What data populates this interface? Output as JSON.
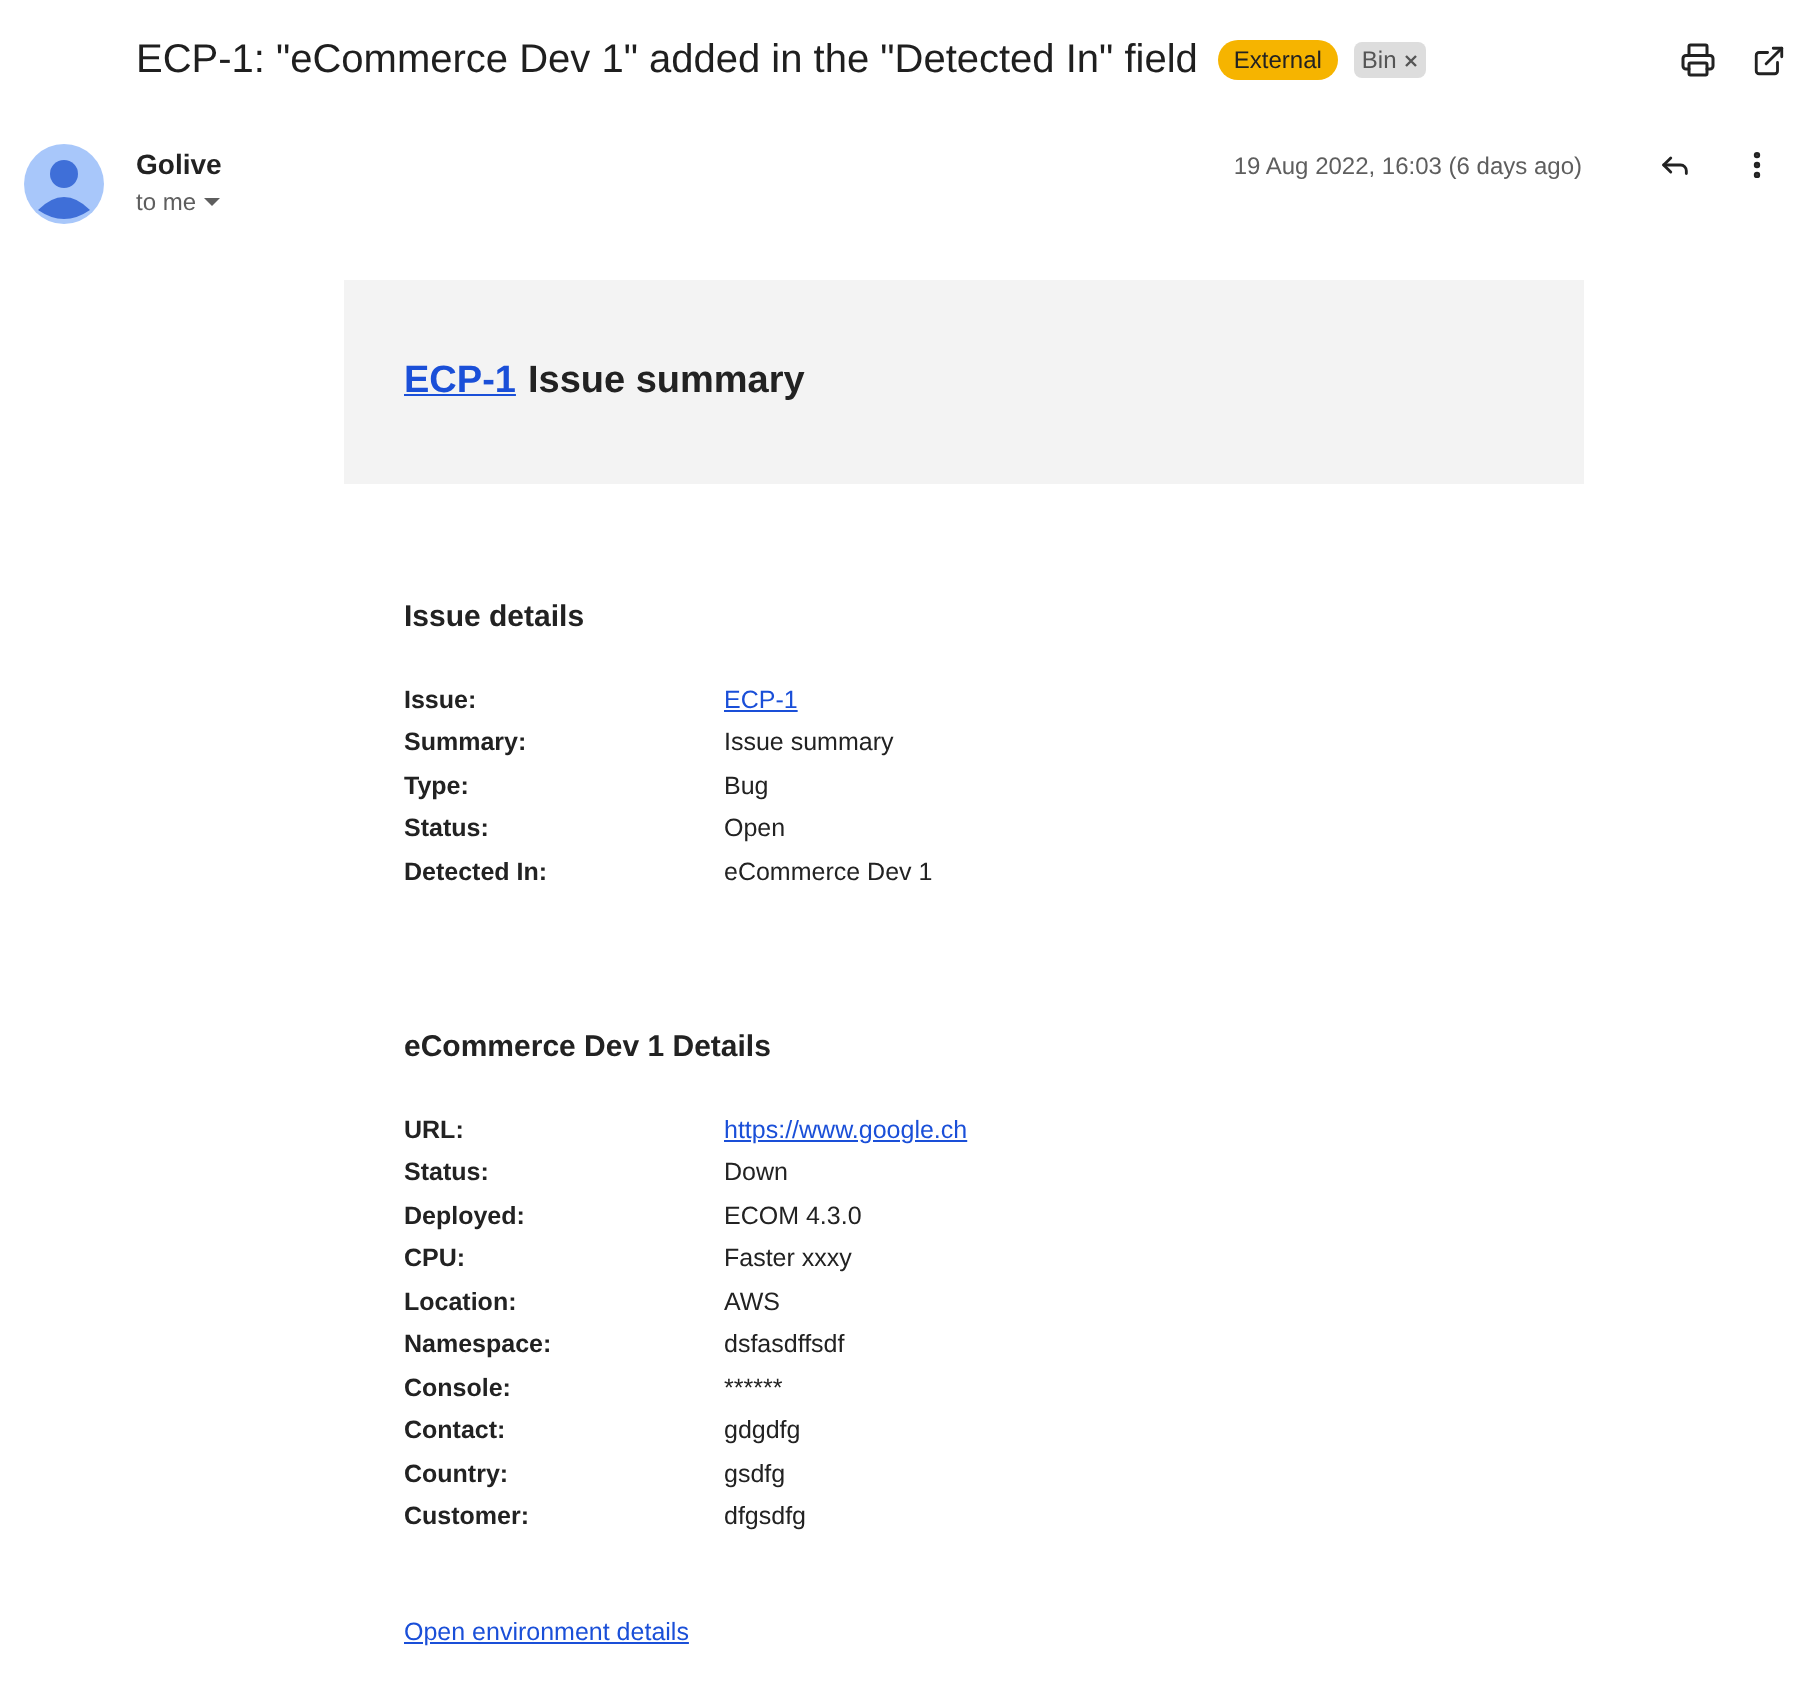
{
  "subject": "ECP-1: \"eCommerce Dev 1\" added in the \"Detected In\" field",
  "labels": [
    {
      "text": "External",
      "kind": "category",
      "color": "#f6b400"
    },
    {
      "text": "Bin",
      "kind": "removable",
      "color": "#dddddd"
    }
  ],
  "sender": {
    "name": "Golive",
    "recipient": "to me",
    "date": "19 Aug 2022, 16:03 (6 days ago)"
  },
  "banner": {
    "link": "ECP-1",
    "title": "Issue summary"
  },
  "sections": [
    {
      "title": "Issue details",
      "rows": [
        {
          "label": "Issue:",
          "value": "ECP-1",
          "kind": "link"
        },
        {
          "label": "Summary:",
          "value": "Issue summary",
          "kind": "text"
        },
        {
          "label": "Type:",
          "value": "Bug",
          "kind": "text"
        },
        {
          "label": "Status:",
          "value": "Open",
          "kind": "text"
        },
        {
          "label": "Detected In:",
          "value": "eCommerce Dev 1",
          "kind": "text"
        }
      ]
    },
    {
      "title": "eCommerce Dev 1 Details",
      "rows": [
        {
          "label": "URL:",
          "value": "https://www.google.ch",
          "kind": "link"
        },
        {
          "label": "Status:",
          "value": "Down",
          "kind": "text"
        },
        {
          "label": "Deployed:",
          "value": "ECOM 4.3.0",
          "kind": "text"
        },
        {
          "label": "CPU:",
          "value": "Faster xxxy",
          "kind": "text"
        },
        {
          "label": "Location:",
          "value": "AWS",
          "kind": "text"
        },
        {
          "label": "Namespace:",
          "value": "dsfasdffsdf",
          "kind": "text"
        },
        {
          "label": "Console:",
          "value": "******",
          "kind": "text"
        },
        {
          "label": "Contact:",
          "value": "gdgdfg",
          "kind": "text"
        },
        {
          "label": "Country:",
          "value": "gsdfg",
          "kind": "text"
        },
        {
          "label": "Customer:",
          "value": "dfgsdfg",
          "kind": "text"
        }
      ]
    }
  ],
  "footer_link": "Open environment details"
}
